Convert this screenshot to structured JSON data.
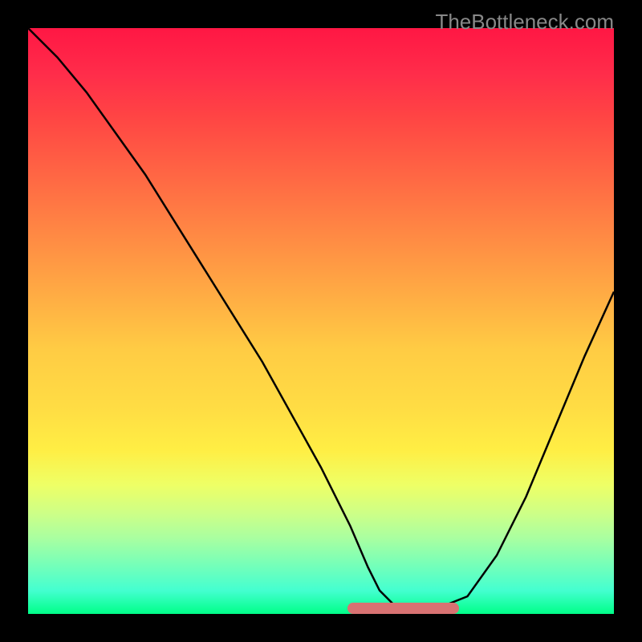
{
  "watermark": "TheBottleneck.com",
  "chart_data": {
    "type": "line",
    "title": "",
    "xlabel": "",
    "ylabel": "",
    "xlim": [
      0,
      100
    ],
    "ylim": [
      0,
      100
    ],
    "x": [
      0,
      5,
      10,
      15,
      20,
      25,
      30,
      35,
      40,
      45,
      50,
      55,
      58,
      60,
      63,
      65,
      68,
      70,
      75,
      80,
      85,
      90,
      95,
      100
    ],
    "values": [
      100,
      95,
      89,
      82,
      75,
      67,
      59,
      51,
      43,
      34,
      25,
      15,
      8,
      4,
      1,
      0,
      0,
      1,
      3,
      10,
      20,
      32,
      44,
      55
    ],
    "optimal_range": {
      "start": 56,
      "end": 72,
      "value": 0
    },
    "description": "Bottleneck curve showing performance deviation. V-shaped curve with minimum near 65% on x-axis. Background gradient from red (high bottleneck) at top to green (optimal) at bottom."
  },
  "bar": {
    "left_pct": 54.5,
    "width_pct": 19
  }
}
